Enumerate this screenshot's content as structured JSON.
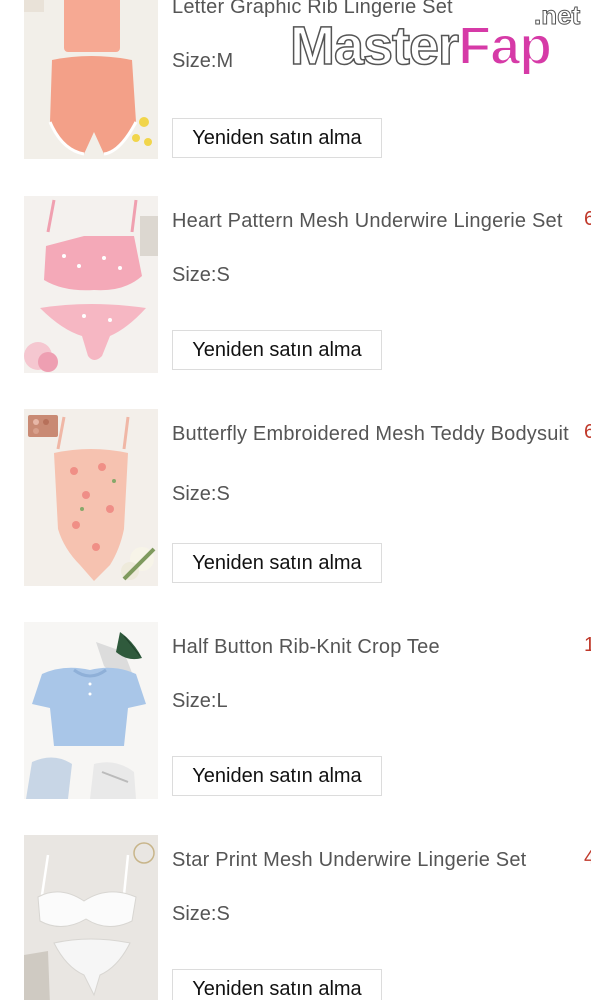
{
  "items": [
    {
      "title": "Letter Graphic Rib Lingerie Set",
      "size": "Size:M",
      "rebuy": "Yeniden satın alma",
      "price": "",
      "thumb_icon": "pink-lingerie-set-photo"
    },
    {
      "title": "Heart Pattern Mesh Underwire Lingerie Set",
      "size": "Size:S",
      "rebuy": "Yeniden satın alma",
      "price": "6",
      "thumb_icon": "pink-mesh-lingerie-photo"
    },
    {
      "title": "Butterfly Embroidered Mesh Teddy Bodysuit",
      "size": "Size:S",
      "rebuy": "Yeniden satın alma",
      "price": "6",
      "thumb_icon": "floral-bodysuit-photo"
    },
    {
      "title": "Half Button Rib-Knit Crop Tee",
      "size": "Size:L",
      "rebuy": "Yeniden satın alma",
      "price": "1",
      "thumb_icon": "blue-crop-tee-photo"
    },
    {
      "title": "Star Print Mesh Underwire Lingerie Set",
      "size": "Size:S",
      "rebuy": "Yeniden satın alma",
      "price": "4",
      "thumb_icon": "white-lace-lingerie-photo"
    }
  ],
  "watermark": {
    "brand": "MasterFap",
    "brand_main": "Master",
    "brand_accent": "Fap",
    "tld": ".net",
    "accent_color": "#d63aa7"
  },
  "colors": {
    "price": "#c0392b",
    "text": "#555555",
    "button_border": "#dcdcdc"
  }
}
